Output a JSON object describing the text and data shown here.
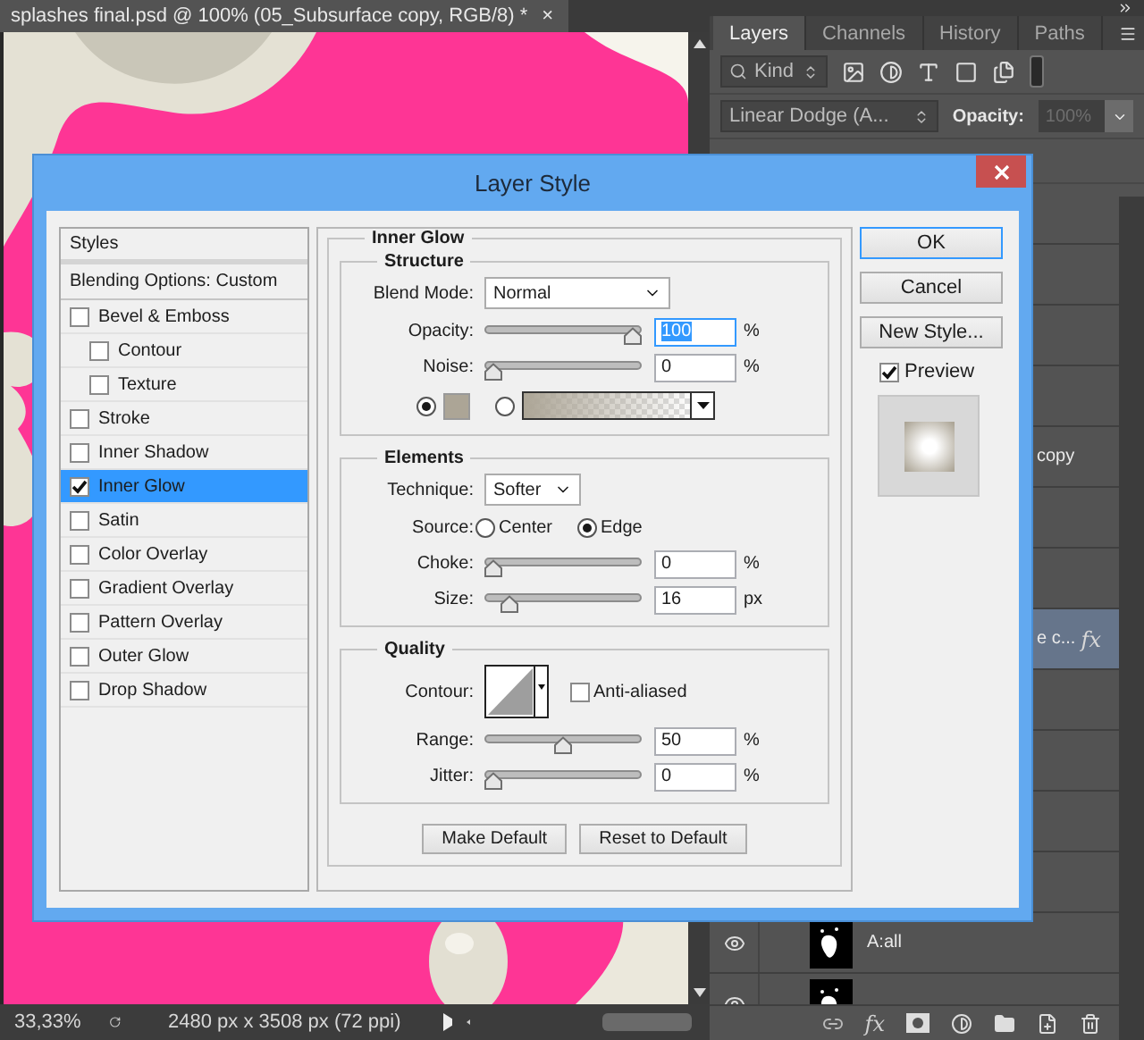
{
  "document_tab": {
    "title": "splashes final.psd @ 100% (05_Subsurface copy, RGB/8) *",
    "close": "×"
  },
  "status_bar": {
    "zoom": "33,33%",
    "doc_size": "2480 px x 3508 px (72 ppi)"
  },
  "layers_panel": {
    "tabs": [
      {
        "label": "Layers",
        "selected": true
      },
      {
        "label": "Channels",
        "selected": false
      },
      {
        "label": "History",
        "selected": false
      },
      {
        "label": "Paths",
        "selected": false
      }
    ],
    "filter": "Kind",
    "blend_mode": "Linear Dodge (A...",
    "opacity_label": "Opacity:",
    "opacity": {
      "value": "100%",
      "disabled": true
    },
    "layers": [
      {
        "kind": "covered",
        "selected": false
      },
      {
        "kind": "covered",
        "selected": false
      },
      {
        "kind": "covered",
        "selected": false
      },
      {
        "kind": "covered",
        "selected": false
      },
      {
        "kind": "covered",
        "name": "copy",
        "selected": false
      },
      {
        "kind": "covered",
        "selected": false
      },
      {
        "kind": "covered",
        "selected": false
      },
      {
        "kind": "covered",
        "name": "e c...",
        "effects": "fx",
        "selected": true
      },
      {
        "kind": "covered",
        "selected": false
      },
      {
        "kind": "covered",
        "selected": false
      },
      {
        "kind": "covered",
        "selected": false
      },
      {
        "kind": "covered",
        "selected": false
      },
      {
        "kind": "full",
        "name": "A:all",
        "visible": true,
        "selected": false
      },
      {
        "kind": "full",
        "visible": true,
        "selected": false
      }
    ],
    "fx_button": "fx"
  },
  "dialog": {
    "title": "Layer Style",
    "styles_header": "Styles",
    "blending_options": "Blending Options: Custom",
    "effects": [
      {
        "label": "Bevel & Emboss",
        "checked": false,
        "selected": false,
        "children": [
          {
            "label": "Contour",
            "checked": false,
            "selected": false
          },
          {
            "label": "Texture",
            "checked": false,
            "selected": false
          }
        ]
      },
      {
        "label": "Stroke",
        "checked": false,
        "selected": false
      },
      {
        "label": "Inner Shadow",
        "checked": false,
        "selected": false
      },
      {
        "label": "Inner Glow",
        "checked": true,
        "selected": true
      },
      {
        "label": "Satin",
        "checked": false,
        "selected": false
      },
      {
        "label": "Color Overlay",
        "checked": false,
        "selected": false
      },
      {
        "label": "Gradient Overlay",
        "checked": false,
        "selected": false
      },
      {
        "label": "Pattern Overlay",
        "checked": false,
        "selected": false
      },
      {
        "label": "Outer Glow",
        "checked": false,
        "selected": false
      },
      {
        "label": "Drop Shadow",
        "checked": false,
        "selected": false
      }
    ],
    "section_title": "Inner Glow",
    "structure": {
      "title": "Structure",
      "blend_mode_label": "Blend Mode:",
      "blend_mode": "Normal",
      "sliders": [
        {
          "label": "Opacity:",
          "level": 1,
          "value": "100",
          "unit": "%",
          "focused": true
        },
        {
          "label": "Noise:",
          "level": 0,
          "value": "0",
          "unit": "%",
          "focused": false
        }
      ],
      "fill_options": [
        {
          "kind": "color",
          "selected": true,
          "color": "#aca596"
        },
        {
          "kind": "gradient",
          "selected": false,
          "color": "#aca596"
        }
      ]
    },
    "elements": {
      "title": "Elements",
      "technique_label": "Technique:",
      "technique": "Softer",
      "source_label": "Source:",
      "sources": [
        {
          "label": "Center",
          "selected": false
        },
        {
          "label": "Edge",
          "selected": true
        }
      ],
      "sliders": [
        {
          "label": "Choke:",
          "level": 0,
          "value": "0",
          "unit": "%",
          "focused": false
        },
        {
          "label": "Size:",
          "level": 0.12,
          "value": "16",
          "unit": "px",
          "focused": false
        }
      ]
    },
    "quality": {
      "title": "Quality",
      "contour_label": "Contour:",
      "anti_aliased": {
        "label": "Anti-aliased",
        "checked": false
      },
      "sliders": [
        {
          "label": "Range:",
          "level": 0.5,
          "value": "50",
          "unit": "%",
          "focused": false
        },
        {
          "label": "Jitter:",
          "level": 0,
          "value": "0",
          "unit": "%",
          "focused": false
        }
      ]
    },
    "buttons": [
      "Make Default",
      "Reset to Default"
    ],
    "actions": [
      {
        "label": "OK",
        "default": true
      },
      {
        "label": "Cancel",
        "default": false
      },
      {
        "label": "New Style...",
        "default": false
      }
    ],
    "preview": {
      "label": "Preview",
      "checked": true
    }
  }
}
